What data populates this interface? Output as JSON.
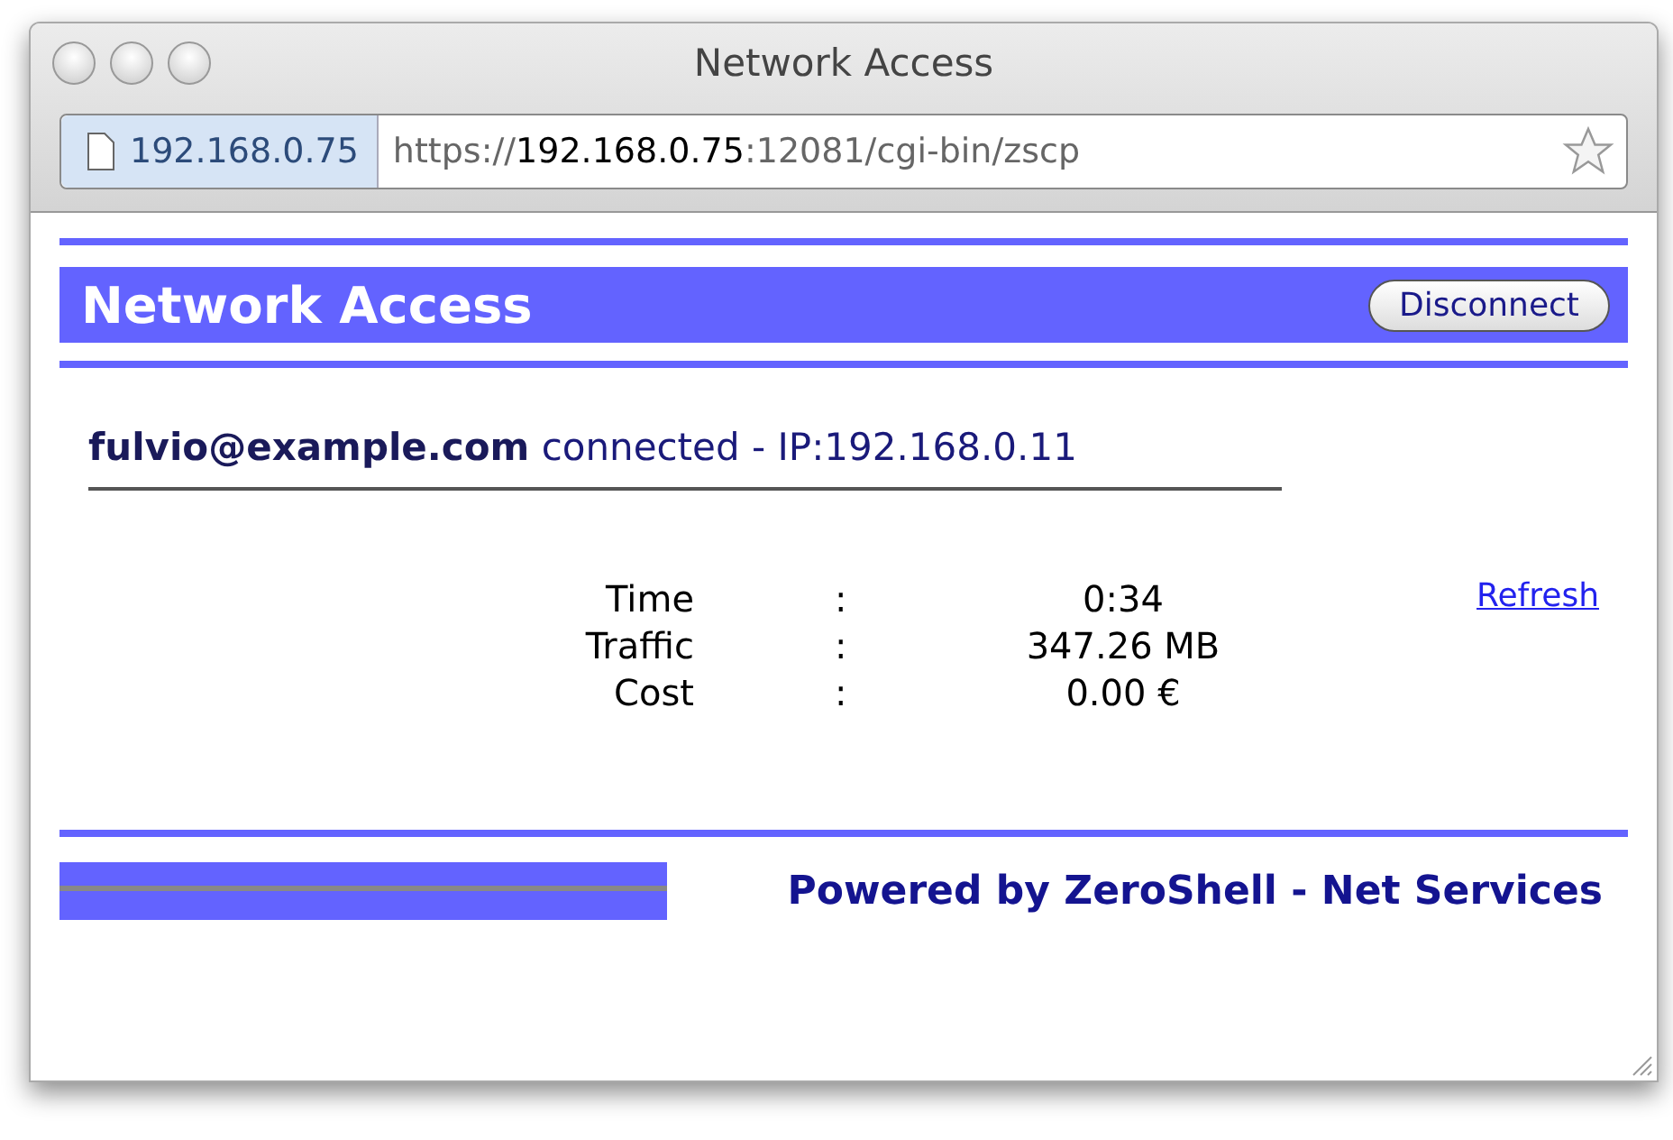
{
  "window": {
    "title": "Network Access"
  },
  "address_bar": {
    "site": "192.168.0.75",
    "url": "https://**192.168.0.75**:12081/cgi-bin/zscp"
  },
  "header": {
    "title": "Network Access",
    "button": "Disconnect"
  },
  "status": "**fulvio@example.com** connected - IP:192.168.0.11",
  "stats": [
    {
      "label": "Time",
      "separator": ":",
      "value": "0:34"
    },
    {
      "label": "Traffic",
      "separator": ":",
      "value": "347.26 MB"
    },
    {
      "label": "Cost",
      "separator": ":",
      "value": "0.00 €"
    }
  ],
  "refresh_link": "Refresh",
  "footer": "Powered by ZeroShell - Net Services"
}
